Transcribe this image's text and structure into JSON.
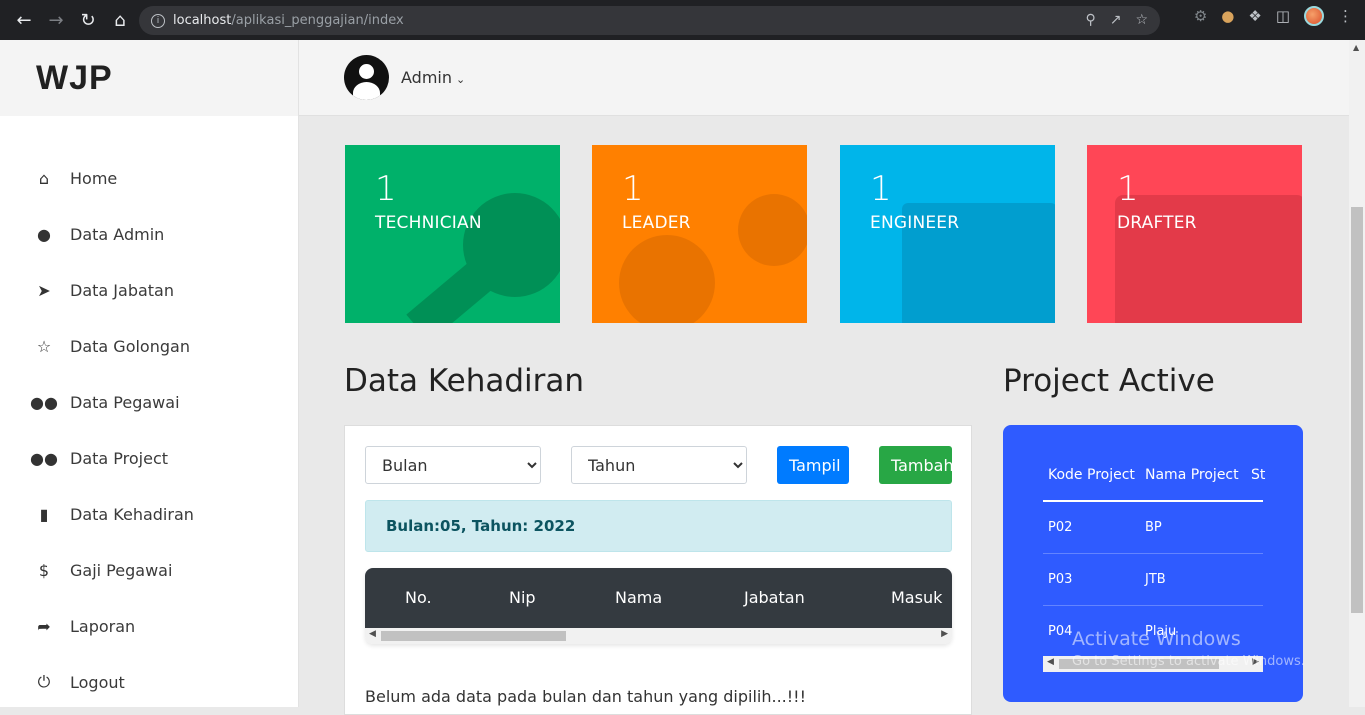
{
  "browser": {
    "url_host": "localhost",
    "url_path": "/aplikasi_penggajian/index"
  },
  "brand": "WJP",
  "user": {
    "name": "Admin"
  },
  "sidebar": {
    "items": [
      {
        "label": "Home",
        "icon": "home-icon"
      },
      {
        "label": "Data Admin",
        "icon": "user-icon"
      },
      {
        "label": "Data Jabatan",
        "icon": "rocket-icon"
      },
      {
        "label": "Data Golongan",
        "icon": "star-icon"
      },
      {
        "label": "Data Pegawai",
        "icon": "users-icon"
      },
      {
        "label": "Data Project",
        "icon": "users-icon"
      },
      {
        "label": "Data Kehadiran",
        "icon": "bar-chart-icon"
      },
      {
        "label": "Gaji Pegawai",
        "icon": "dollar-icon"
      },
      {
        "label": "Laporan",
        "icon": "share-icon"
      },
      {
        "label": "Logout",
        "icon": "power-icon"
      }
    ]
  },
  "stats": [
    {
      "count": "1",
      "label": "TECHNICIAN",
      "color": "#00b16a"
    },
    {
      "count": "1",
      "label": "LEADER",
      "color": "#ff8000"
    },
    {
      "count": "1",
      "label": "ENGINEER",
      "color": "#00b5ea"
    },
    {
      "count": "1",
      "label": "DRAFTER",
      "color": "#ff4656"
    }
  ],
  "kehadiran": {
    "title": "Data Kehadiran",
    "bulan_select": "Bulan",
    "tahun_select": "Tahun",
    "tampil_button": "Tampil",
    "tambah_button": "Tambah",
    "alert": "Bulan:05, Tahun: 2022",
    "columns": [
      "No.",
      "Nip",
      "Nama",
      "Jabatan",
      "Masuk"
    ],
    "empty_message": "Belum ada data pada bulan dan tahun yang dipilih...!!!"
  },
  "project": {
    "title": "Project Active",
    "columns": [
      "Kode Project",
      "Nama Project",
      "St"
    ],
    "rows": [
      {
        "kode": "P02",
        "nama": "BP"
      },
      {
        "kode": "P03",
        "nama": "JTB"
      },
      {
        "kode": "P04",
        "nama": "Plaju"
      }
    ]
  },
  "watermark": {
    "line1": "Activate Windows",
    "line2": "Go to Settings to activate Windows."
  }
}
